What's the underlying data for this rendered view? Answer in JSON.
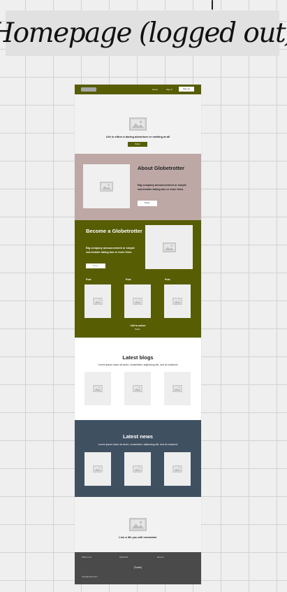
{
  "board_title": "Homepage (logged out)",
  "nav": {
    "home": "Home",
    "sign_in": "Sign in",
    "sign_up": "Sign up"
  },
  "hero": {
    "tagline": "Life is either a daring adventure or nothing at all",
    "button": "Button"
  },
  "about": {
    "heading": "About Globetrotter",
    "text": "Big company announcement or simple sub-header taking two or more lines.",
    "button": "Button"
  },
  "become": {
    "heading": "Become a Globetrotter",
    "text": "Big company announcement or simple sub-header taking two or more lines.",
    "button": "Button",
    "posts": [
      "Post",
      "Post",
      "Post"
    ],
    "cta": "Call to action",
    "cta_button": "Button"
  },
  "blogs": {
    "heading": "Latest blogs",
    "subtitle": "Lorem ipsum dolor sit amet, consectetur adipiscing elit, sed do eiusmod"
  },
  "news": {
    "heading": "Latest news",
    "subtitle": "Lorem ipsum dolor sit amet, consectetur adipiscing elit, sed do eiusmod"
  },
  "footer_hero": {
    "tagline": "Live a life you will remember"
  },
  "footer": {
    "links": [
      "Follow us on",
      "Quick links",
      "About us"
    ],
    "center": "Footer",
    "copyright": "Copyright goes here"
  },
  "colors": {
    "olive": "#565d02",
    "mauve": "#bda8a6",
    "slate": "#3f5061",
    "footer": "#4a4a4a"
  }
}
